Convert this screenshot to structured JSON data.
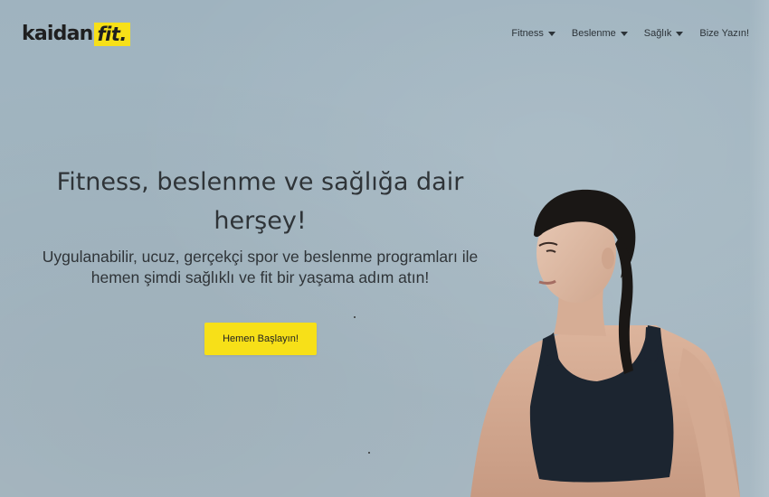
{
  "header": {
    "logo": {
      "main": "kaidan",
      "accent": "fit."
    },
    "nav": [
      {
        "label": "Fitness",
        "has_dropdown": true
      },
      {
        "label": "Beslenme",
        "has_dropdown": true
      },
      {
        "label": "Sağlık",
        "has_dropdown": true
      },
      {
        "label": "Bize Yazın!",
        "has_dropdown": false
      }
    ]
  },
  "hero": {
    "title": "Fitness, beslenme ve sağlığa dair herşey!",
    "subtitle": "Uygulanabilir, ucuz, gerçekçi spor ve beslenme programları ile hemen şimdi sağlıklı ve fit bir yaşama adım atın!",
    "cta_label": "Hemen Başlayın!",
    "image": "fitness-woman-photo"
  },
  "colors": {
    "background": "#a3b6c1",
    "accent_yellow": "#f7e018",
    "text_dark": "#2f3438"
  },
  "icons": {
    "dropdown": "chevron-down-icon"
  }
}
